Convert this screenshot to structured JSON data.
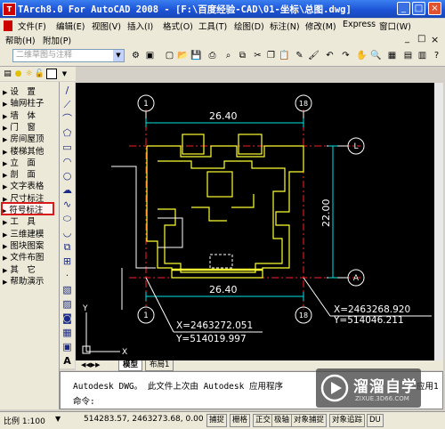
{
  "window": {
    "title": "TArch8.0 For AutoCAD 2008 - [F:\\百度经验-CAD\\01-坐标\\总图.dwg]",
    "app_icon": "T",
    "minimize": "_",
    "maximize": "□",
    "close": "×"
  },
  "menu": {
    "items": [
      "文件(F)",
      "编辑(E)",
      "视图(V)",
      "插入(I)",
      "格式(O)",
      "工具(T)",
      "绘图(D)",
      "标注(N)",
      "修改(M)",
      "Express",
      "窗口(W)"
    ],
    "items2": [
      "帮助(H)",
      "附加(P)"
    ],
    "doc_min": "_",
    "doc_max": "□",
    "doc_close": "×"
  },
  "toolbar": {
    "workspace": "二维草图与注释"
  },
  "sidebar": {
    "items": [
      {
        "label": "设　置",
        "active": false
      },
      {
        "label": "轴网柱子",
        "active": false
      },
      {
        "label": "墙　体",
        "active": false
      },
      {
        "label": "门　窗",
        "active": false
      },
      {
        "label": "房间屋顶",
        "active": false
      },
      {
        "label": "楼梯其他",
        "active": false
      },
      {
        "label": "立　面",
        "active": false
      },
      {
        "label": "剖　面",
        "active": false
      },
      {
        "label": "文字表格",
        "active": false
      },
      {
        "label": "尺寸标注",
        "active": false
      },
      {
        "label": "符号标注",
        "active": true
      },
      {
        "label": "工　具",
        "active": false
      },
      {
        "label": "三维建模",
        "active": false
      },
      {
        "label": "图块图案",
        "active": false
      },
      {
        "label": "文件布图",
        "active": false
      },
      {
        "label": "其　它",
        "active": false
      },
      {
        "label": "帮助演示",
        "active": false
      }
    ]
  },
  "drawing": {
    "dim_top": "26.40",
    "dim_bottom": "26.40",
    "dim_right": "22.00",
    "axis_1_top": "1",
    "axis_18_top": "18",
    "axis_L": "L",
    "axis_A": "A",
    "axis_1_bottom": "1",
    "axis_18_bottom": "18",
    "coord_left_x": "X=2463272.051",
    "coord_left_y": "Y=514019.997",
    "coord_right_x": "X=2463268.920",
    "coord_right_y": "Y=514046.211",
    "ucs_x": "X",
    "ucs_y": "Y"
  },
  "tabs": [
    "模型",
    "布局1"
  ],
  "command": {
    "history": "Autodesk DWG。  此文件上次由 Autodesk 应用程序",
    "history_tail": "应用1",
    "prompt": "命令:"
  },
  "status": {
    "scale": "比例 1:100",
    "coords": "514283.57, 2463273.68, 0.00",
    "buttons": [
      "捕捉",
      "栅格",
      "正交",
      "极轴",
      "对象捕捉",
      "对象追踪",
      "DU"
    ]
  },
  "watermark": {
    "text": "溜溜自学",
    "url": "ZIXUE.3D66.COM"
  },
  "colors": {
    "canvas": "#000000",
    "outline_yellow": "#ffff00",
    "axis_red": "#ff0000",
    "dim_cyan": "#00ffff",
    "titlebar": "#1d54d6",
    "active_outline": "#d91a1a"
  }
}
